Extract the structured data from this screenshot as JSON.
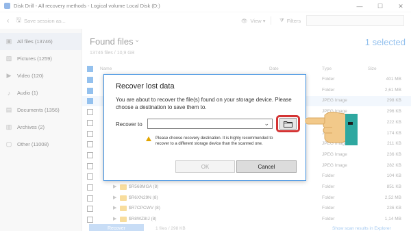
{
  "window": {
    "title": "Disk Drill - All recovery methods - Logical volume Local Disk (D:)",
    "minimize": "—",
    "maximize": "☐",
    "close": "✕"
  },
  "toolbar": {
    "back": "‹",
    "save_session": "Save session as...",
    "view": "View ▾",
    "filters": "Filters"
  },
  "sidebar": {
    "items": [
      {
        "label": "All files (13746)",
        "icon": "files-icon",
        "glyph": "▣"
      },
      {
        "label": "Pictures (1259)",
        "icon": "picture-icon",
        "glyph": "▨"
      },
      {
        "label": "Video (120)",
        "icon": "video-icon",
        "glyph": "▶"
      },
      {
        "label": "Audio (1)",
        "icon": "music-icon",
        "glyph": "♪"
      },
      {
        "label": "Documents (1356)",
        "icon": "document-icon",
        "glyph": "▤"
      },
      {
        "label": "Archives (2)",
        "icon": "archive-icon",
        "glyph": "▥"
      },
      {
        "label": "Other (11008)",
        "icon": "other-icon",
        "glyph": "▢"
      }
    ]
  },
  "main": {
    "title": "Found files",
    "subtitle": "13746 files / 10,9 GB",
    "selected": "1 selected",
    "columns": {
      "name": "Name",
      "date": "Date",
      "type": "Type",
      "size": "Size"
    },
    "rows": [
      {
        "name": "",
        "type": "Folder",
        "size": "401 MB",
        "checked": true,
        "selected": false,
        "folder": false
      },
      {
        "name": "",
        "type": "Folder",
        "size": "2,61 MB",
        "checked": true,
        "selected": false,
        "folder": false
      },
      {
        "name": "",
        "type": "JPEG Image",
        "size": "298 KB",
        "checked": true,
        "selected": true,
        "folder": false
      },
      {
        "name": "",
        "type": "JPEG Image",
        "size": "296 KB",
        "checked": false,
        "selected": false,
        "folder": false
      },
      {
        "name": "",
        "type": "JPEG Image",
        "size": "222 KB",
        "checked": false,
        "selected": false,
        "folder": false
      },
      {
        "name": "",
        "type": "JPEG Image",
        "size": "174 KB",
        "checked": false,
        "selected": false,
        "folder": false
      },
      {
        "name": "",
        "type": "JPEG Image",
        "size": "211 KB",
        "checked": false,
        "selected": false,
        "folder": false
      },
      {
        "name": "",
        "type": "JPEG Image",
        "size": "236 KB",
        "checked": false,
        "selected": false,
        "folder": false
      },
      {
        "name": "",
        "type": "JPEG Image",
        "size": "282 KB",
        "checked": false,
        "selected": false,
        "folder": false
      },
      {
        "name": "",
        "type": "Folder",
        "size": "104 KB",
        "checked": false,
        "selected": false,
        "folder": false
      },
      {
        "name": "$R568MGA (8)",
        "type": "Folder",
        "size": "851 KB",
        "checked": false,
        "selected": false,
        "folder": true
      },
      {
        "name": "$R6XN29N (8)",
        "type": "Folder",
        "size": "2,52 MB",
        "checked": false,
        "selected": false,
        "folder": true
      },
      {
        "name": "$R7CPCWV (8)",
        "type": "Folder",
        "size": "236 KB",
        "checked": false,
        "selected": false,
        "folder": true
      },
      {
        "name": "$R8WZ8IJ (8)",
        "type": "Folder",
        "size": "1,14 MB",
        "checked": false,
        "selected": false,
        "folder": true
      }
    ],
    "recover_button": "Recover",
    "bottom_info": "1 files / 298 KB",
    "show_scan": "Show scan results in Explorer"
  },
  "dialog": {
    "title": "Recover lost data",
    "text": "You are about to recover the file(s) found on your storage device. Please choose a destination to save them to.",
    "recover_to_label": "Recover to",
    "recover_to_value": "",
    "warning": "Please choose recovery destination. It is highly recommended to recover to a different storage device than the scanned one.",
    "ok": "OK",
    "cancel": "Cancel"
  },
  "colors": {
    "accent": "#3d8fe0",
    "highlight_ring": "#d43434",
    "warning": "#e2a500"
  }
}
